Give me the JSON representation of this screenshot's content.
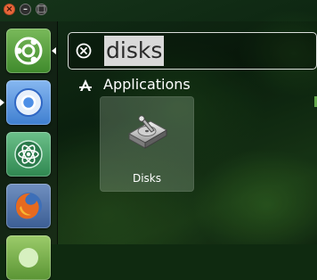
{
  "window_controls": {
    "close_glyph": "×",
    "minimize_glyph": "–",
    "maximize_glyph": "□"
  },
  "launcher": {
    "items": [
      {
        "name": "Ubuntu Dash",
        "icon": "ubuntu-logo-icon",
        "active": true
      },
      {
        "name": "Chromium",
        "icon": "chromium-icon",
        "running": true
      },
      {
        "name": "Atom",
        "icon": "atom-icon"
      },
      {
        "name": "Firefox",
        "icon": "firefox-icon"
      },
      {
        "name": "",
        "icon": "app-icon"
      }
    ]
  },
  "dash": {
    "search": {
      "query": "disks",
      "clear_icon": "clear-search-icon"
    },
    "category": {
      "label": "Applications",
      "icon": "applications-icon"
    },
    "results": [
      {
        "label": "Disks",
        "icon": "disks-icon"
      }
    ]
  },
  "colors": {
    "wallpaper_dark": "#0c2410",
    "wallpaper_leaf": "#3c7828",
    "close_button": "#e8673b",
    "search_highlight": "#d9d9d9",
    "text": "#ffffff"
  }
}
